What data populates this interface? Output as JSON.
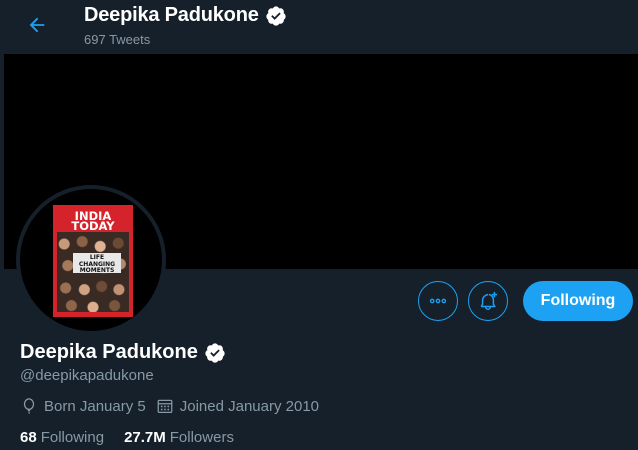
{
  "header": {
    "name": "Deepika Padukone",
    "tweet_count": "697 Tweets"
  },
  "avatar": {
    "magazine_title_line1": "INDIA",
    "magazine_title_line2": "TODAY",
    "magazine_band": "LIFE CHANGING MOMENTS"
  },
  "actions": {
    "following_label": "Following"
  },
  "profile": {
    "name": "Deepika Padukone",
    "handle": "@deepikapadukone",
    "born": "Born January 5",
    "joined": "Joined January 2010"
  },
  "stats": {
    "following_count": "68",
    "following_label": "Following",
    "followers_count": "27.7M",
    "followers_label": "Followers"
  },
  "colors": {
    "background": "#15202b",
    "accent": "#1da1f2",
    "secondary_text": "#8899a6",
    "banner": "#000000"
  },
  "icons": [
    "back-arrow-icon",
    "verified-badge-icon",
    "more-icon",
    "bell-plus-icon",
    "balloon-icon",
    "calendar-icon"
  ]
}
